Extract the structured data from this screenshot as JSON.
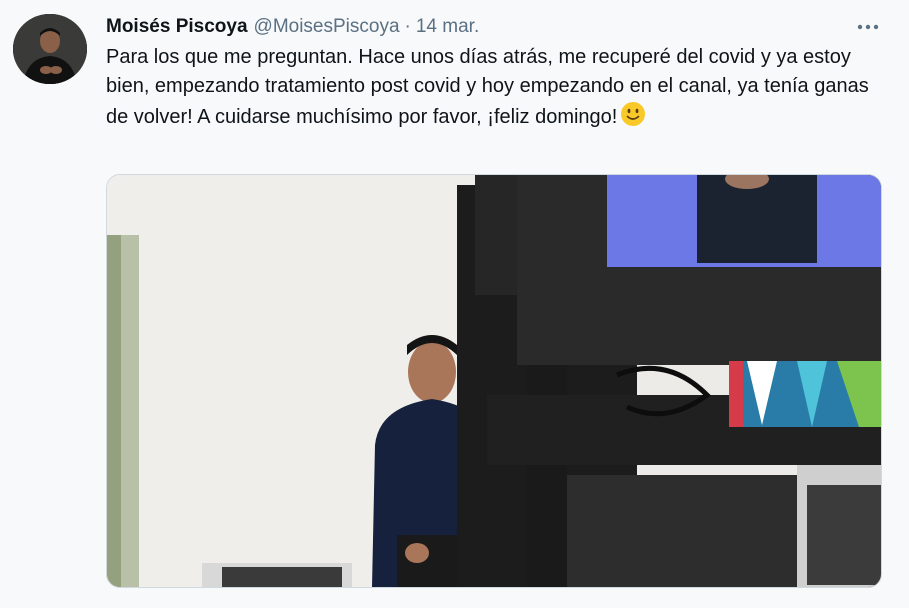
{
  "tweet": {
    "author": {
      "display_name": "Moisés Piscoya",
      "handle": "@MoisesPiscoya"
    },
    "separator": "·",
    "date": "14 mar.",
    "text": "Para los que me preguntan. Hace unos días atrás, me recuperé del covid y ya estoy bien, empezando tratamiento post covid y hoy empezando en el canal, ya tenía ganas de volver! A cuidarse muchísimo por favor, ¡feliz domingo!",
    "emoji": "slightly-smiling-face",
    "more_icon": "more-horizontal-icon",
    "media": {
      "type": "photo",
      "description_icon": "tv-studio-photo"
    }
  },
  "colors": {
    "background": "#f7f9fa",
    "text": "#0f1419",
    "secondary_text": "#5b7083",
    "emoji_yellow": "#f9c829"
  }
}
